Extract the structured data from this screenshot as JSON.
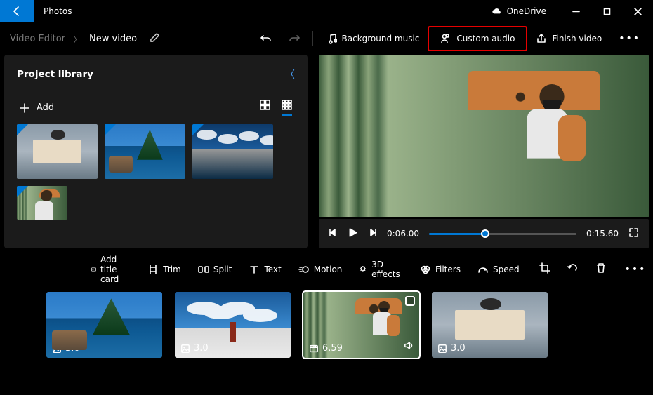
{
  "app": {
    "name": "Photos"
  },
  "onedrive": {
    "label": "OneDrive"
  },
  "breadcrumb": {
    "parent": "Video Editor",
    "current": "New video"
  },
  "toolbar": {
    "bg_music": "Background music",
    "custom_audio": "Custom audio",
    "finish": "Finish video"
  },
  "library": {
    "title": "Project library",
    "add": "Add"
  },
  "player": {
    "current_time": "0:06.00",
    "total_time": "0:15.60"
  },
  "sb_toolbar": {
    "title_card": "Add title card",
    "trim": "Trim",
    "split": "Split",
    "text": "Text",
    "motion": "Motion",
    "effects": "3D effects",
    "filters": "Filters",
    "speed": "Speed"
  },
  "clips": [
    {
      "duration": "3.0",
      "type": "image"
    },
    {
      "duration": "3.0",
      "type": "image"
    },
    {
      "duration": "6.59",
      "type": "video",
      "selected": true,
      "audio": true
    },
    {
      "duration": "3.0",
      "type": "image"
    }
  ]
}
